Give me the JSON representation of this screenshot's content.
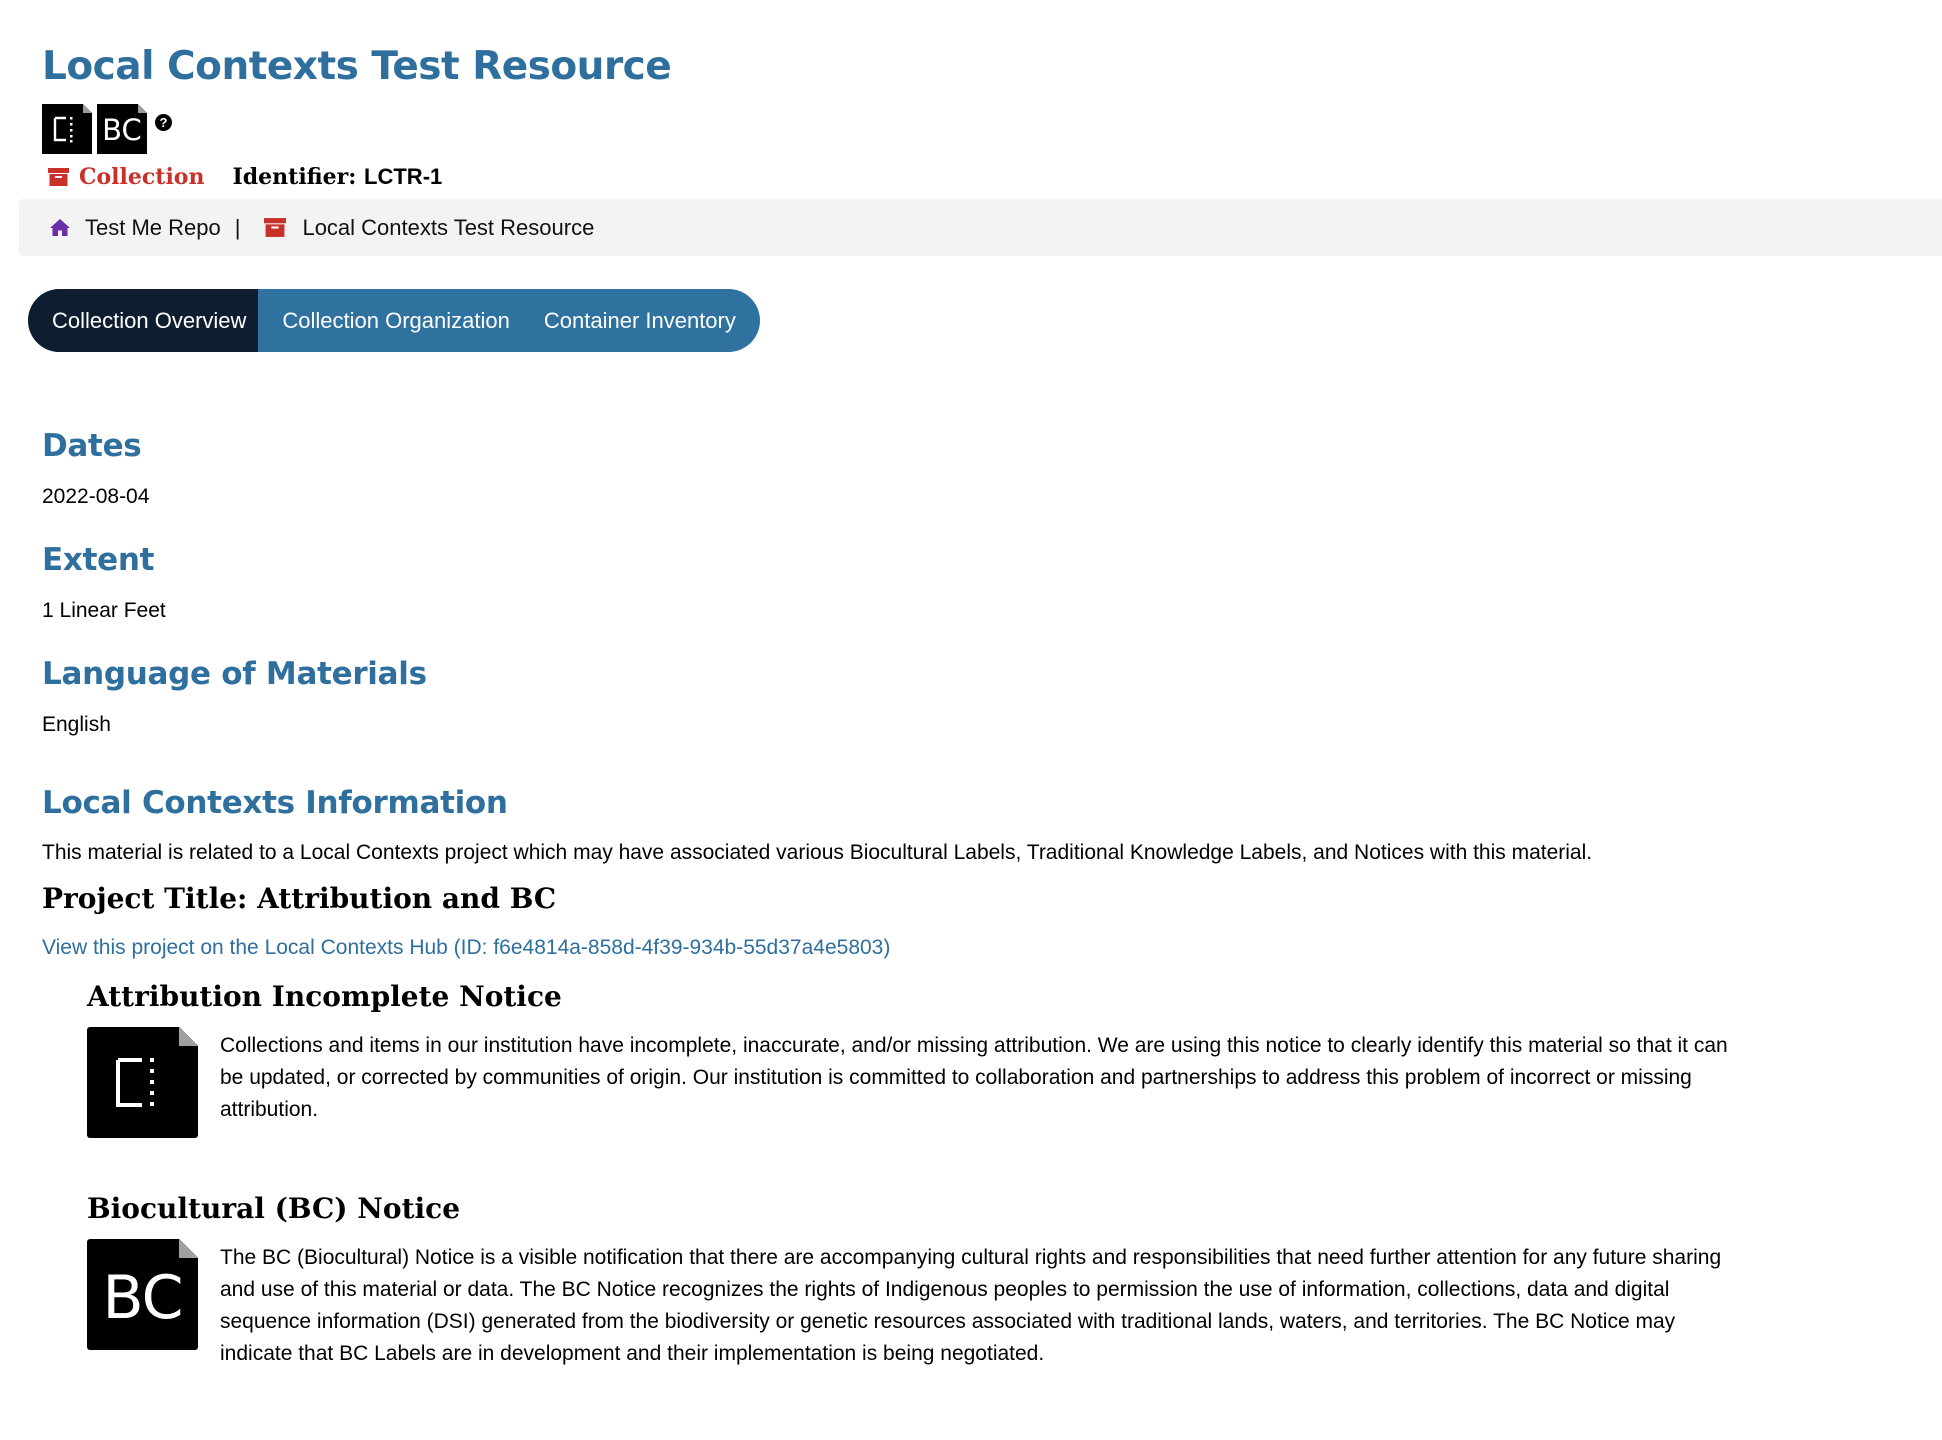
{
  "resource": {
    "title": "Local Contexts Test Resource",
    "mini_notices": [
      {
        "icon": "attribution-incomplete-icon"
      },
      {
        "icon": "biocultural-notice-icon",
        "text": "BC"
      }
    ],
    "help_icon_text": "?",
    "type_label": "Collection",
    "identifier_label": "Identifier:",
    "identifier_value": "LCTR-1"
  },
  "breadcrumb": {
    "repo": "Test Me Repo",
    "separator": "|",
    "resource": "Local Contexts Test Resource"
  },
  "tabs": [
    {
      "label": "Collection Overview",
      "active": true
    },
    {
      "label": "Collection Organization",
      "active": false
    },
    {
      "label": "Container Inventory",
      "active": false
    }
  ],
  "sections": {
    "dates": {
      "heading": "Dates",
      "value": "2022-08-04"
    },
    "extent": {
      "heading": "Extent",
      "value": "1 Linear Feet"
    },
    "language": {
      "heading": "Language of Materials",
      "value": "English"
    }
  },
  "local_contexts": {
    "heading": "Local Contexts Information",
    "intro": "This material is related to a Local Contexts project which may have associated various Biocultural Labels, Traditional Knowledge Labels, and Notices with this material.",
    "project_title": "Project Title: Attribution and BC",
    "project_link": "View this project on the Local Contexts Hub (ID: f6e4814a-858d-4f39-934b-55d37a4e5803)",
    "notices": [
      {
        "title": "Attribution Incomplete Notice",
        "icon": "attribution-incomplete-icon",
        "text": "Collections and items in our institution have incomplete, inaccurate, and/or missing attribution. We are using this notice to clearly identify this material so that it can be updated, or corrected by communities of origin. Our institution is committed to collaboration and partnerships to address this problem of incorrect or missing attribution."
      },
      {
        "title": "Biocultural (BC) Notice",
        "icon": "biocultural-notice-icon",
        "icon_text": "BC",
        "text": "The BC (Biocultural) Notice is a visible notification that there are accompanying cultural rights and responsibilities that need further attention for any future sharing and use of this material or data. The BC Notice recognizes the rights of Indigenous peoples to permission the use of information, collections, data and digital sequence information (DSI) generated from the biodiversity or genetic resources associated with traditional lands, waters, and territories. The BC Notice may indicate that BC Labels are in development and their implementation is being negotiated."
      }
    ]
  },
  "colors": {
    "heading_blue": "#2e6f9e",
    "collection_red": "#c8302a",
    "home_purple": "#6a2ea8",
    "tab_active": "#0e1e30",
    "tab_bg": "#2f729f",
    "breadcrumb_bg": "#f3f3f3"
  }
}
